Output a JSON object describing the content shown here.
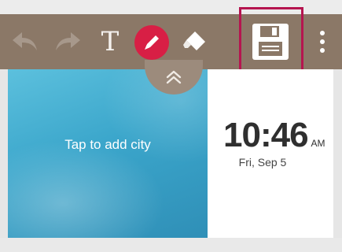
{
  "toolbar": {
    "text_tool_label": "T",
    "icons": {
      "undo": "undo-icon",
      "redo": "redo-icon",
      "text": "text-tool-icon",
      "pen": "pen-icon",
      "eraser": "eraser-icon",
      "save": "save-icon",
      "more": "more-vert-icon"
    },
    "colors": {
      "background": "#8b7867",
      "pen_accent": "#d81f45",
      "save_highlight": "#b5154f"
    }
  },
  "widget": {
    "city_prompt": "Tap to add city",
    "time": "10:46",
    "ampm": "AM",
    "date": "Fri, Sep 5"
  },
  "collapse": {
    "icon": "chevron-up-double-icon"
  }
}
